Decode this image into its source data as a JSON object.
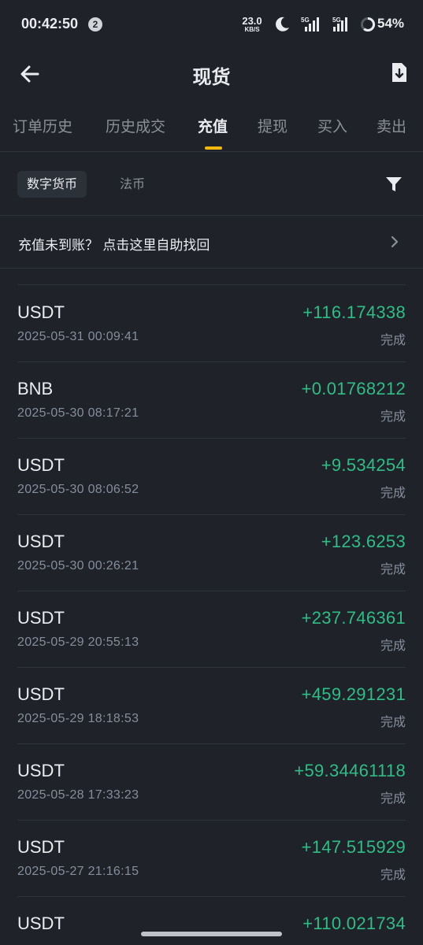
{
  "status_bar": {
    "time": "00:42:50",
    "notification_count": "2",
    "net_speed_value": "23.0",
    "net_speed_unit": "KB/S",
    "sig1_label": "5G",
    "sig2_label": "5G",
    "battery": "54%"
  },
  "header": {
    "title": "现货"
  },
  "tabs": [
    {
      "label": "订单历史"
    },
    {
      "label": "历史成交"
    },
    {
      "label": "充值"
    },
    {
      "label": "提现"
    },
    {
      "label": "买入"
    },
    {
      "label": "卖出"
    }
  ],
  "active_tab_index": 2,
  "filters": {
    "crypto": "数字货币",
    "fiat": "法币"
  },
  "help": {
    "text": "充值未到账？ 点击这里自助找回"
  },
  "deposits": [
    {
      "coin": "USDT",
      "date": "2025-05-31 00:09:41",
      "amount": "+116.174338",
      "status": "完成"
    },
    {
      "coin": "BNB",
      "date": "2025-05-30 08:17:21",
      "amount": "+0.01768212",
      "status": "完成"
    },
    {
      "coin": "USDT",
      "date": "2025-05-30 08:06:52",
      "amount": "+9.534254",
      "status": "完成"
    },
    {
      "coin": "USDT",
      "date": "2025-05-30 00:26:21",
      "amount": "+123.6253",
      "status": "完成"
    },
    {
      "coin": "USDT",
      "date": "2025-05-29 20:55:13",
      "amount": "+237.746361",
      "status": "完成"
    },
    {
      "coin": "USDT",
      "date": "2025-05-29 18:18:53",
      "amount": "+459.291231",
      "status": "完成"
    },
    {
      "coin": "USDT",
      "date": "2025-05-28 17:33:23",
      "amount": "+59.34461118",
      "status": "完成"
    },
    {
      "coin": "USDT",
      "date": "2025-05-27 21:16:15",
      "amount": "+147.515929",
      "status": "完成"
    },
    {
      "coin": "USDT",
      "date": "",
      "amount": "+110.021734",
      "status": ""
    }
  ],
  "colors": {
    "background": "#1f2329",
    "accent": "#f0b90b",
    "positive": "#2ebd85",
    "muted": "#848e9c"
  }
}
